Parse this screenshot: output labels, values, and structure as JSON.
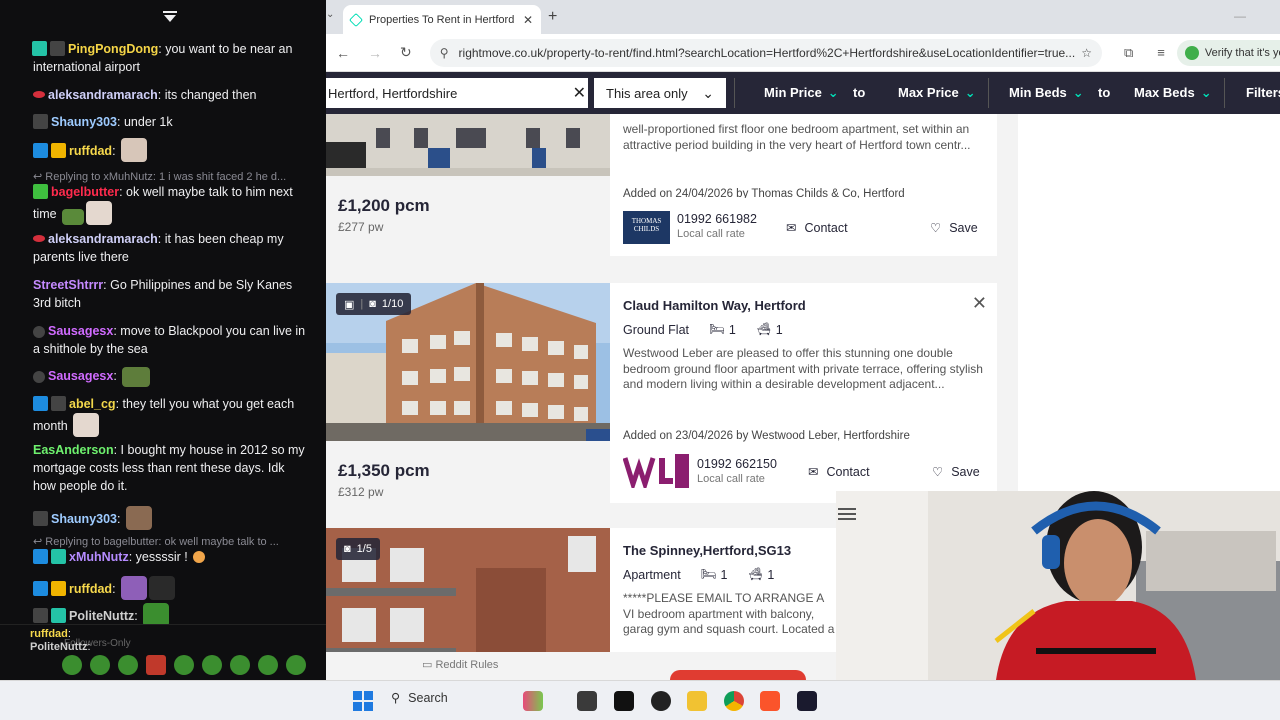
{
  "chat": {
    "messages": [
      {
        "user": "PingPongDong",
        "color": "#f5d547",
        "text": "you want to be near an international airport"
      },
      {
        "user": "aleksandramarach",
        "color": "#cfcff7",
        "text": "its changed then"
      },
      {
        "user": "Shauny303",
        "color": "#9ecbff",
        "text": "under 1k"
      },
      {
        "user": "ruffdad",
        "color": "#f7d94c",
        "text": ""
      },
      {
        "reply": "Replying to xMuhNutz: 1 i was shit faced 2 he d..."
      },
      {
        "user": "bagelbutter",
        "color": "#ff2b4d",
        "text": "ok well maybe talk to him next time"
      },
      {
        "user": "aleksandramarach",
        "color": "#cfcff7",
        "text": "it has been cheap my parents live there"
      },
      {
        "user": "StreetShtrrr",
        "color": "#c58aff",
        "text": "Go Philippines and be Sly Kanes 3rd bitch"
      },
      {
        "user": "Sausagesx",
        "color": "#d06bff",
        "text": "move to Blackpool you can live in a shithole by the sea"
      },
      {
        "user": "Sausagesx",
        "color": "#d06bff",
        "text": ""
      },
      {
        "user": "abel_cg",
        "color": "#f2d74b",
        "text": "they tell you what you get each month"
      },
      {
        "user": "EasAnderson",
        "color": "#6ef16e",
        "text": "I bought my house in 2012 so my mortgage costs less than rent these days. Idk how people do it."
      },
      {
        "user": "Shauny303",
        "color": "#9ecbff",
        "text": ""
      },
      {
        "reply": "Replying to bagelbutter: ok well maybe talk to ..."
      },
      {
        "user": "xMuhNutz",
        "color": "#b58bff",
        "text": "yessssir !"
      },
      {
        "user": "ruffdad",
        "color": "#f7d94c",
        "text": ""
      },
      {
        "user": "PoliteNuttz",
        "color": "#cfcfcf",
        "text": ""
      },
      {
        "user": "ruffdad",
        "color": "#f7d94c",
        "text": ""
      },
      {
        "user": "PoliteNuttz",
        "color": "#cfcfcf",
        "text": ""
      }
    ],
    "followers_only": "Followers-Only"
  },
  "browser": {
    "tab_title": "Properties To Rent in Hertford |",
    "url": "rightmove.co.uk/property-to-rent/find.html?searchLocation=Hertford%2C+Hertfordshire&useLocationIdentifier=true...",
    "verify_text": "Verify that it's you"
  },
  "filters": {
    "location": "Hertford, Hertfordshire",
    "area": "This area only",
    "min_price": "Min Price",
    "to1": "to",
    "max_price": "Max Price",
    "min_beds": "Min Beds",
    "to2": "to",
    "max_beds": "Max Beds",
    "more": "Filters"
  },
  "listings": [
    {
      "price": "£1,200 pcm",
      "pw": "£277 pw",
      "description": "well-proportioned first floor one bedroom apartment, set within an attractive period building in the very heart of Hertford town centr...",
      "added": "Added on 24/04/2026 by Thomas Childs & Co, Hertford",
      "agent_logo_text": "THOMAS CHILDS",
      "phone": "01992 661982",
      "local_rate": "Local call rate",
      "contact": "Contact",
      "save": "Save"
    },
    {
      "photo_count": "1/10",
      "address": "Claud Hamilton Way, Hertford",
      "type": "Ground Flat",
      "beds": "1",
      "baths": "1",
      "description": "Westwood Leber are pleased to offer this stunning one double bedroom ground floor apartment with private terrace, offering stylish and modern living within a desirable development adjacent...",
      "added": "Added on 23/04/2026 by Westwood Leber, Hertfordshire",
      "phone": "01992 662150",
      "local_rate": "Local call rate",
      "contact": "Contact",
      "save": "Save",
      "price": "£1,350 pcm",
      "pw": "£312 pw"
    },
    {
      "photo_count": "1/5",
      "address": "The Spinney,Hertford,SG13",
      "type": "Apartment",
      "beds": "1",
      "baths": "1",
      "description": "*****PLEASE EMAIL TO ARRANGE A VI bedroom apartment with balcony, garag gym and squash court. Located a short c"
    }
  ],
  "reddit_rules": "Reddit Rules",
  "taskbar": {
    "search": "Search"
  },
  "colors": {
    "brand_navy": "#262637",
    "brand_teal": "#00deb6"
  }
}
